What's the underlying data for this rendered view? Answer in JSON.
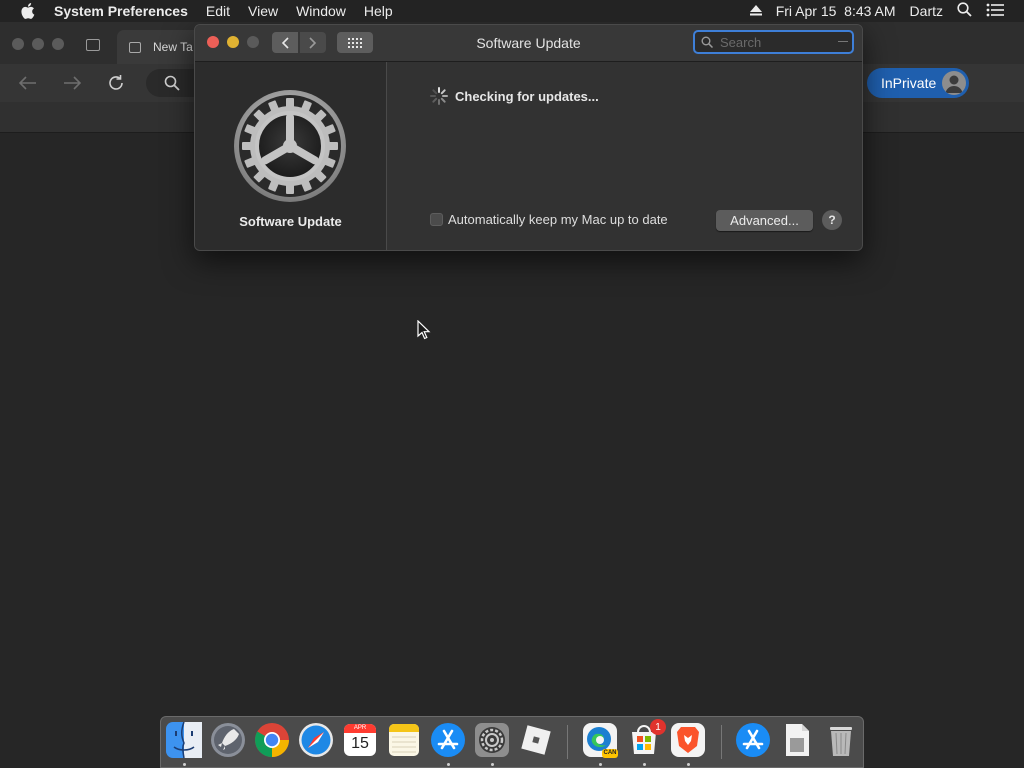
{
  "menubar": {
    "app_name": "System Preferences",
    "menus": [
      "Edit",
      "View",
      "Window",
      "Help"
    ],
    "datetime": "Fri Apr 15  8:43 AM",
    "user": "Dartz"
  },
  "browser": {
    "tab_title": "New Ta",
    "inprivate_label": "InPrivate"
  },
  "window": {
    "title": "Software Update",
    "search_placeholder": "Search",
    "sidebar_title": "Software Update",
    "status_text": "Checking for updates...",
    "auto_update_label": "Automatically keep my Mac up to date",
    "auto_update_checked": false,
    "advanced_label": "Advanced...",
    "help_label": "?"
  },
  "dock": {
    "apps": [
      "Finder",
      "Launchpad",
      "Google Chrome",
      "Safari",
      "Calendar",
      "Notes",
      "App Store",
      "System Preferences",
      "Roblox",
      "Microsoft Edge",
      "Microsoft Store",
      "Brave",
      "App Store",
      "Documents",
      "Trash"
    ],
    "calendar_month": "APR",
    "calendar_day": "15",
    "edge_badge": "CAN",
    "store_badge": "1"
  },
  "colors": {
    "close": "#ec5f57",
    "minimize": "#e0b232",
    "accent": "#3e7fd8",
    "inprivate": "#1f5fae"
  }
}
